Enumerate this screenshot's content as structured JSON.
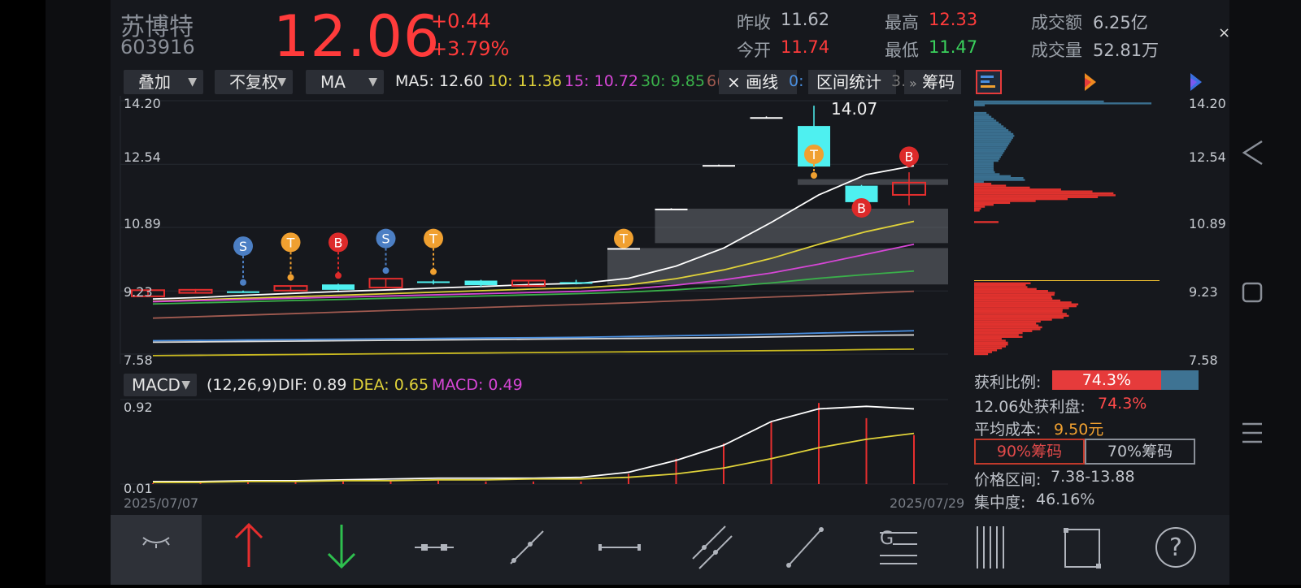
{
  "stock": {
    "name": "苏博特",
    "code": "603916",
    "price": "12.06",
    "change": "+0.44",
    "change_pct": "+3.79%"
  },
  "quote": {
    "prev_close_label": "昨收",
    "prev_close": "11.62",
    "open_label": "今开",
    "open": "11.74",
    "high_label": "最高",
    "high": "12.33",
    "low_label": "最低",
    "low": "11.47",
    "amount_label": "成交额",
    "amount": "6.25亿",
    "volume_label": "成交量",
    "volume": "52.81万"
  },
  "close_icon": "×",
  "toolbar": {
    "overlay": "叠加",
    "adjust": "不复权",
    "indicator": "MA",
    "ma5": "MA5: 12.60",
    "ma10": "10: 11.36",
    "ma15": "15: 10.72",
    "ma30": "30: 9.85",
    "ma60": "6(",
    "draw": "× 画线",
    "ma_cut": "0:",
    "range_stats": "区间统计",
    "range_cut": "3.2",
    "chips_arrow": "»",
    "chips": "筹码"
  },
  "chart_data": {
    "type": "candlestick",
    "y_ticks": [
      "14.20",
      "12.54",
      "10.89",
      "9.23",
      "7.58"
    ],
    "ylim": [
      7.58,
      14.2
    ],
    "high_annotation": "14.07",
    "date_start": "2025/07/07",
    "date_end": "2025/07/29",
    "candles": [
      {
        "o": 9.09,
        "c": 9.25,
        "h": 9.25,
        "l": 9.09,
        "dir": "up"
      },
      {
        "o": 9.18,
        "c": 9.26,
        "h": 9.28,
        "l": 9.16,
        "dir": "up"
      },
      {
        "o": 9.2,
        "c": 9.22,
        "h": 9.24,
        "l": 9.18,
        "dir": "down"
      },
      {
        "o": 9.24,
        "c": 9.36,
        "h": 9.37,
        "l": 9.22,
        "dir": "up"
      },
      {
        "o": 9.4,
        "c": 9.26,
        "h": 9.42,
        "l": 9.24,
        "dir": "down"
      },
      {
        "o": 9.32,
        "c": 9.55,
        "h": 9.55,
        "l": 9.3,
        "dir": "up"
      },
      {
        "o": 9.48,
        "c": 9.44,
        "h": 9.52,
        "l": 9.4,
        "dir": "down"
      },
      {
        "o": 9.5,
        "c": 9.38,
        "h": 9.52,
        "l": 9.34,
        "dir": "down"
      },
      {
        "o": 9.36,
        "c": 9.5,
        "h": 9.52,
        "l": 9.34,
        "dir": "up"
      },
      {
        "o": 9.46,
        "c": 9.42,
        "h": 9.52,
        "l": 9.4,
        "dir": "down"
      },
      {
        "o": 10.35,
        "c": 10.35,
        "h": 10.36,
        "l": 10.34,
        "dir": "flat"
      },
      {
        "o": 11.38,
        "c": 11.38,
        "h": 11.39,
        "l": 11.37,
        "dir": "flat"
      },
      {
        "o": 12.52,
        "c": 12.52,
        "h": 12.53,
        "l": 12.51,
        "dir": "flat"
      },
      {
        "o": 13.77,
        "c": 13.77,
        "h": 13.79,
        "l": 13.76,
        "dir": "flat"
      },
      {
        "o": 13.54,
        "c": 12.48,
        "h": 14.07,
        "l": 12.46,
        "dir": "down"
      },
      {
        "o": 11.98,
        "c": 11.55,
        "h": 12.0,
        "l": 11.5,
        "dir": "down"
      },
      {
        "o": 11.74,
        "c": 12.06,
        "h": 12.33,
        "l": 11.47,
        "dir": "up"
      }
    ],
    "signals": [
      {
        "idx": 2,
        "label": "S",
        "color": "#4c7fc4",
        "y": 10.4
      },
      {
        "idx": 3,
        "label": "T",
        "color": "#f0a030",
        "y": 10.5
      },
      {
        "idx": 4,
        "label": "B",
        "color": "#dd2a2a",
        "y": 10.5
      },
      {
        "idx": 5,
        "label": "S",
        "color": "#4c7fc4",
        "y": 10.6
      },
      {
        "idx": 6,
        "label": "T",
        "color": "#f0a030",
        "y": 10.6
      },
      {
        "idx": 10,
        "label": "T",
        "color": "#f0a030",
        "y": 10.6
      },
      {
        "idx": 14,
        "label": "T",
        "color": "#f0a030",
        "y": 12.8
      },
      {
        "idx": 15,
        "label": "B",
        "color": "#dd2a2a",
        "y": 11.4
      },
      {
        "idx": 16,
        "label": "B",
        "color": "#dd2a2a",
        "y": 12.75
      }
    ],
    "ma_lines": [
      {
        "name": "MA5",
        "color": "#ffffff",
        "values": [
          8.98,
          9.02,
          9.06,
          9.12,
          9.17,
          9.22,
          9.26,
          9.31,
          9.35,
          9.4,
          9.43,
          9.56,
          9.88,
          10.35,
          11.02,
          11.74,
          12.27,
          12.5,
          12.6
        ]
      },
      {
        "name": "MA10",
        "color": "#e0d23a",
        "values": [
          8.93,
          8.96,
          9.0,
          9.04,
          9.08,
          9.12,
          9.16,
          9.2,
          9.24,
          9.28,
          9.31,
          9.39,
          9.55,
          9.78,
          10.08,
          10.45,
          10.78,
          11.05,
          11.36
        ]
      },
      {
        "name": "MA15",
        "color": "#d646d6",
        "values": [
          8.92,
          8.95,
          8.98,
          9.01,
          9.04,
          9.07,
          9.1,
          9.13,
          9.16,
          9.19,
          9.22,
          9.28,
          9.38,
          9.52,
          9.7,
          9.93,
          10.19,
          10.45,
          10.72
        ]
      },
      {
        "name": "MA30",
        "color": "#3ab04a",
        "values": [
          8.86,
          8.89,
          8.92,
          8.95,
          8.98,
          9.01,
          9.04,
          9.07,
          9.1,
          9.13,
          9.16,
          9.2,
          9.26,
          9.34,
          9.44,
          9.56,
          9.66,
          9.75,
          9.85
        ]
      },
      {
        "name": "MA60",
        "color": "#a05a50",
        "values": [
          8.48,
          8.52,
          8.56,
          8.6,
          8.64,
          8.68,
          8.72,
          8.76,
          8.8,
          8.84,
          8.88,
          8.92,
          8.97,
          9.02,
          9.07,
          9.12,
          9.17,
          9.22,
          9.27
        ]
      },
      {
        "name": "",
        "color": "#4a8fe0",
        "values": [
          7.92,
          7.93,
          7.94,
          7.95,
          7.96,
          7.97,
          7.98,
          7.99,
          8.0,
          8.01,
          8.02,
          8.04,
          8.06,
          8.08,
          8.1,
          8.13,
          8.16,
          8.19,
          8.22
        ]
      },
      {
        "name": "",
        "color": "#d8d8d8",
        "values": [
          7.88,
          7.89,
          7.9,
          7.91,
          7.92,
          7.93,
          7.94,
          7.95,
          7.96,
          7.97,
          7.98,
          7.99,
          8.0,
          8.01,
          8.03,
          8.05,
          8.07,
          8.08,
          8.1
        ]
      },
      {
        "name": "",
        "color": "#c8b820",
        "values": [
          7.53,
          7.54,
          7.55,
          7.56,
          7.57,
          7.58,
          7.59,
          7.6,
          7.61,
          7.62,
          7.63,
          7.64,
          7.65,
          7.66,
          7.67,
          7.68,
          7.7,
          7.71,
          7.73
        ]
      }
    ],
    "zones": [
      {
        "from_idx": 10,
        "y_low": 9.4,
        "y_high": 10.35
      },
      {
        "from_idx": 11,
        "y_low": 10.48,
        "y_high": 11.38
      },
      {
        "from_idx": 14,
        "y_low": 12.0,
        "y_high": 12.15
      }
    ]
  },
  "macd": {
    "select": "MACD",
    "params": "(12,26,9)",
    "dif": "DIF: 0.89",
    "dea": "DEA: 0.65",
    "macd": "MACD: 0.49",
    "y_top": "0.92",
    "y_bottom": "0.01",
    "dif_values": [
      0.02,
      0.03,
      0.03,
      0.04,
      0.04,
      0.05,
      0.06,
      0.07,
      0.07,
      0.07,
      0.08,
      0.14,
      0.28,
      0.46,
      0.74,
      0.89,
      0.92,
      0.89,
      0.89
    ],
    "dea_values": [
      0.02,
      0.02,
      0.02,
      0.03,
      0.03,
      0.04,
      0.04,
      0.05,
      0.05,
      0.06,
      0.06,
      0.08,
      0.12,
      0.19,
      0.3,
      0.43,
      0.53,
      0.6,
      0.65
    ],
    "bar_values": [
      0.0,
      0.01,
      0.02,
      0.02,
      0.03,
      0.03,
      0.04,
      0.04,
      0.03,
      0.03,
      0.03,
      0.12,
      0.3,
      0.48,
      0.74,
      0.96,
      0.78,
      0.58,
      0.49
    ]
  },
  "chips": {
    "y_ticks": [
      "14.20",
      "12.54",
      "10.89",
      "9.23",
      "7.58"
    ],
    "profit_label": "获利比例:",
    "profit_value": "74.3%",
    "profit_ratio": 0.743,
    "at_price_label": "12.06处获利盘:",
    "at_price_value": "74.3%",
    "avg_cost_label": "平均成本:",
    "avg_cost_value": "9.50元",
    "btn90": "90%筹码",
    "btn70": "70%筹码",
    "range_label": "价格区间:",
    "range_value": "7.38-13.88",
    "concentration_label": "集中度:",
    "concentration_value": "46.16%"
  },
  "bottom_tools": [
    "eye-hide-icon",
    "arrow-up-icon",
    "arrow-down-icon",
    "segment-icon",
    "ray-icon",
    "horizontal-line-icon",
    "parallel-line-icon",
    "trend-line-icon",
    "gann-icon",
    "vertical-lines-icon",
    "rectangle-icon",
    "help-icon"
  ]
}
